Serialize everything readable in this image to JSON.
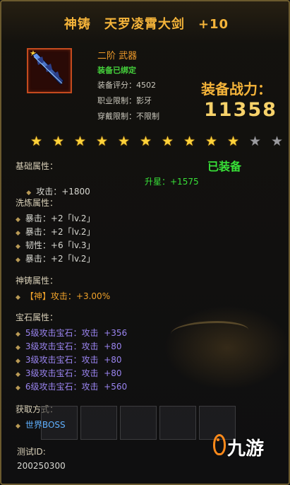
{
  "title": "神铸　天罗凌霄大剑　+10",
  "item": {
    "icon": "sword-icon",
    "tier": "二阶  武器",
    "bound": "装备已绑定",
    "score": "装备评分：4502",
    "class_limit": "职业限制：影牙",
    "wear_limit": "穿戴限制：不限制"
  },
  "power": {
    "label": "装备战力：",
    "value": "11358"
  },
  "stars": {
    "filled": 10,
    "total": 12
  },
  "equipped_status": "已装备",
  "base": {
    "header": "基础属性：",
    "attack": "攻击：+1800",
    "upgrade": "升星：+1575"
  },
  "refine": {
    "header": "洗炼属性：",
    "items": [
      "暴击：+2「lv.2」",
      "暴击：+2「lv.2」",
      "韧性：+6「lv.3」",
      "暴击：+2「lv.2」"
    ]
  },
  "forge": {
    "header": "神铸属性：",
    "items": [
      "【神】攻击：+3.00%"
    ]
  },
  "gems": {
    "header": "宝石属性：",
    "items": [
      "5级攻击宝石：攻击  +356",
      "3级攻击宝石：攻击  +80",
      "3级攻击宝石：攻击  +80",
      "3级攻击宝石：攻击  +80",
      "6级攻击宝石：攻击  +560"
    ]
  },
  "obtain": {
    "header": "获取方式：",
    "items": [
      "世界BOSS"
    ]
  },
  "test_id": {
    "label": "测试ID:",
    "value": "200250300"
  },
  "watermark": "九游",
  "colors": {
    "title": "#f5b43a",
    "green": "#38e038",
    "orange": "#f0a22a",
    "purple": "#9a84f0",
    "star": "#ffd23a",
    "star_empty": "#9a9a9e"
  }
}
